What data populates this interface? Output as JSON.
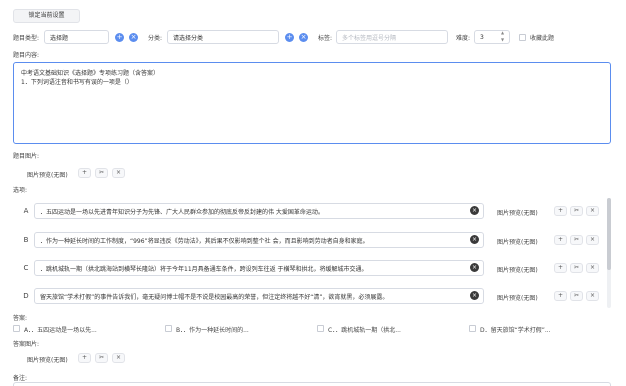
{
  "toolbar": {
    "pin_label": "锁定当前设置"
  },
  "meta": {
    "type_label": "题目类型:",
    "type_value": "选择题",
    "category_label": "分类:",
    "category_value": "请选择分类",
    "tags_label": "标签:",
    "tags_placeholder": "多个标签用逗号分隔",
    "difficulty_label": "难度:",
    "difficulty_value": "3",
    "favorite_label": "收藏此题"
  },
  "content": {
    "label": "题目内容:",
    "line1": "中考语文基础知识《选择题》专项练习题（含答案）",
    "line2": "1．下列词语注音和书写有误的一项是（）"
  },
  "question_image": {
    "label": "题目图片:",
    "preview": "图片预览(无图)"
  },
  "options": {
    "label": "选项:",
    "items": [
      {
        "letter": "A",
        "text": "．五四运动是一场以先进青年知识分子为先锋、广大人民群众参加的彻底反帝反封建的伟 大爱国革命运动。",
        "preview": "图片预览(无图)"
      },
      {
        "letter": "B",
        "text": "．作为一种延长时间的工作制度，“996”将显违反《劳动法》，其后果不仅影响到整个社 会，而且影响到劳动者自身和家庭。",
        "preview": "图片预览(无图)"
      },
      {
        "letter": "C",
        "text": "．跳机城轨一期（拱北跳海站到横琴长隆站）将于今年11月具备通车条件，跨设列车往返 于横琴和拱北，将缓解城市交通。",
        "preview": "图片预览(无图)"
      },
      {
        "letter": "D",
        "text": "留天旅馆“学术打假”的事件告诉我们，毫无疑问博士帽不是不说是校园最高的荣誉，但注定终将越不好“清”，欲宵就黑，必须展露。",
        "preview": "图片预览(无图)"
      }
    ]
  },
  "answer": {
    "label": "答案:",
    "choices": [
      "A．．五四运动是一场以先...",
      "B．．作为一种延长时间的...",
      "C．．跳机城轨一期（拱北...",
      "D．留天旅馆“学术打假”..."
    ]
  },
  "answer_image": {
    "label": "答案图片:",
    "preview": "图片预览(无图)"
  },
  "notes": {
    "label": "备注:"
  },
  "icons": {
    "add": "+",
    "crop": "✂",
    "remove": "×",
    "clear": "×",
    "up": "▲",
    "down": "▼"
  },
  "colors": {
    "accent": "#5b8def",
    "scrollbar": "#c9ccd2"
  }
}
